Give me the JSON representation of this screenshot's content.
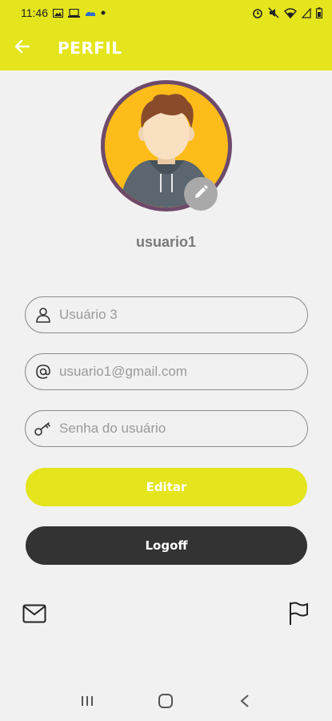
{
  "status_bar": {
    "time": "11:46",
    "left_icons": [
      "image-icon",
      "laptop-icon",
      "weather-icon",
      "dot-icon"
    ],
    "right_icons": [
      "alarm-icon",
      "mute-icon",
      "wifi-icon",
      "signal-icon",
      "battery-icon"
    ]
  },
  "app_bar": {
    "title": "PERFIL",
    "back_icon": "arrow-left-icon",
    "background": "#e4e51c"
  },
  "profile": {
    "username": "usuario1",
    "avatar_icon": "user-avatar-icon",
    "edit_icon": "pencil-icon"
  },
  "form": {
    "name_placeholder": "Usuário 3",
    "email_placeholder": "usuario1@gmail.com",
    "password_placeholder": "Senha do usuário",
    "name_icon": "person-icon",
    "email_icon": "at-icon",
    "password_icon": "key-icon"
  },
  "buttons": {
    "edit_label": "Editar",
    "logoff_label": "Logoff",
    "edit_color": "#e4e51c",
    "logoff_color": "#333333"
  },
  "footer": {
    "left_icon": "mail-icon",
    "right_icon": "flag-icon"
  },
  "nav_bar": {
    "icons": [
      "recent-apps-icon",
      "home-icon",
      "back-icon"
    ]
  }
}
